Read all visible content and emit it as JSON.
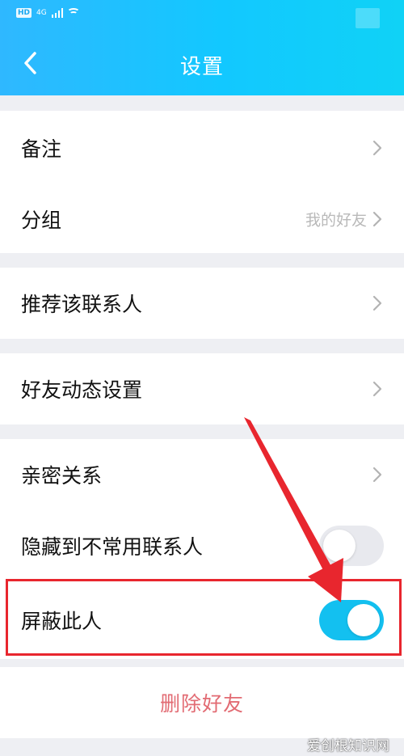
{
  "status_bar": {
    "hd_label": "HD",
    "network_label": "4G"
  },
  "header": {
    "title": "设置",
    "background": "#12c8ff",
    "back_icon": "chevron-left-icon"
  },
  "groups": [
    {
      "items": [
        {
          "label": "备注",
          "value": "",
          "control": "chevron"
        },
        {
          "label": "分组",
          "value": "我的好友",
          "control": "chevron"
        }
      ]
    },
    {
      "items": [
        {
          "label": "推荐该联系人",
          "value": "",
          "control": "chevron"
        }
      ]
    },
    {
      "items": [
        {
          "label": "好友动态设置",
          "value": "",
          "control": "chevron"
        }
      ]
    },
    {
      "items": [
        {
          "label": "亲密关系",
          "value": "",
          "control": "chevron"
        },
        {
          "label": "隐藏到不常用联系人",
          "value": "",
          "control": "toggle",
          "checked": false
        },
        {
          "label": "屏蔽此人",
          "value": "",
          "control": "toggle",
          "checked": true
        }
      ]
    }
  ],
  "delete_button": {
    "label": "删除好友",
    "color": "#e26b73"
  },
  "annotation": {
    "color": "#e8262e",
    "shape": "arrow-and-box"
  },
  "watermark": "爱创根知识网",
  "colors": {
    "accent": "#13c0f0",
    "toggle_off": "#e8e9ee",
    "page_bg": "#eeeff3"
  }
}
